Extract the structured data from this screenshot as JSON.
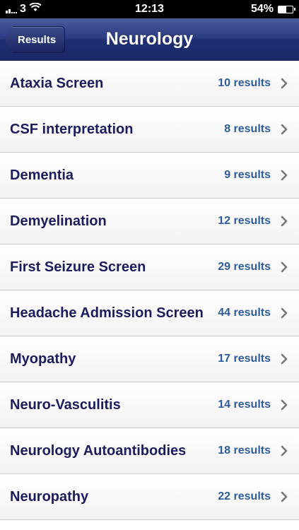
{
  "status_bar": {
    "carrier": "3",
    "time": "12:13",
    "battery_percent": "54%",
    "battery_level": 0.54,
    "icons": [
      "signal-icon",
      "wifi-icon",
      "battery-icon"
    ]
  },
  "nav": {
    "back_label": "Results",
    "title": "Neurology"
  },
  "rows": [
    {
      "label": "Ataxia Screen",
      "count": "10 results"
    },
    {
      "label": "CSF interpretation",
      "count": "8 results"
    },
    {
      "label": "Dementia",
      "count": "9 results"
    },
    {
      "label": "Demyelination",
      "count": "12 results"
    },
    {
      "label": "First Seizure Screen",
      "count": "29 results"
    },
    {
      "label": "Headache Admission Screen",
      "count": "44 results"
    },
    {
      "label": "Myopathy",
      "count": "17 results"
    },
    {
      "label": "Neuro-Vasculitis",
      "count": "14 results"
    },
    {
      "label": "Neurology Autoantibodies",
      "count": "18 results"
    },
    {
      "label": "Neuropathy",
      "count": "22 results"
    }
  ],
  "colors": {
    "nav_gradient_top": "#4a5a9c",
    "nav_gradient_bottom": "#1a2868",
    "row_label": "#1c1c5c",
    "row_count": "#2e5b9a",
    "chevron": "#777777"
  }
}
